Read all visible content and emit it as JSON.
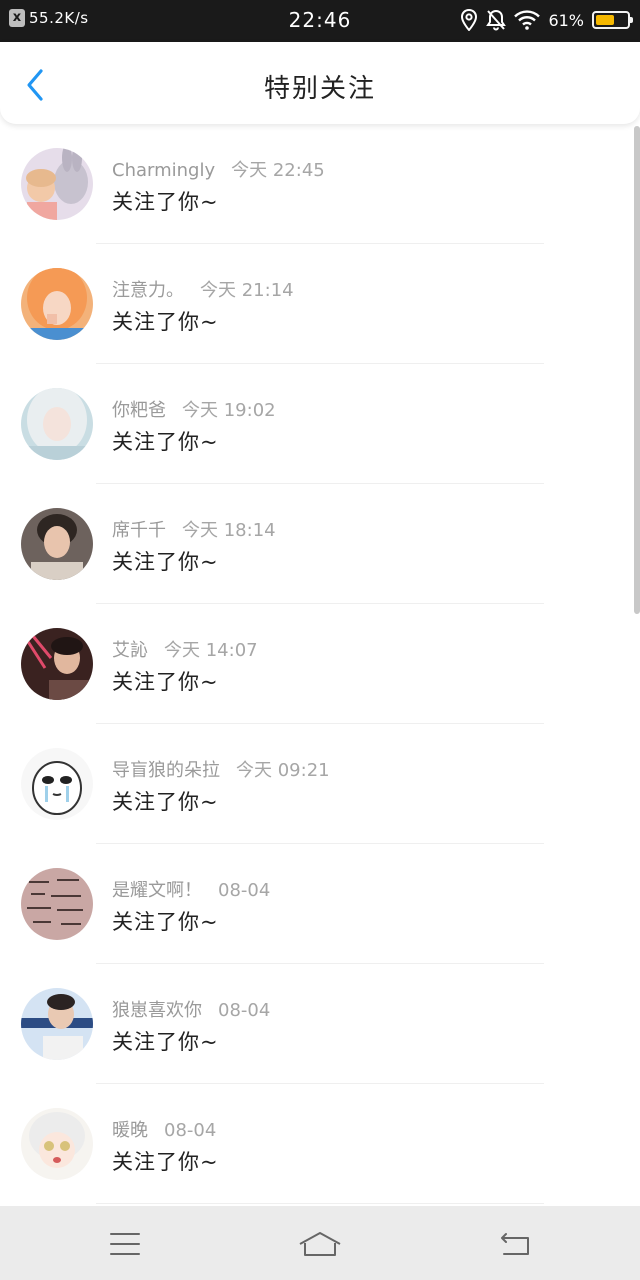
{
  "status_bar": {
    "notification_icon": "x",
    "net_speed": "55.2K/s",
    "time": "22:46",
    "battery_pct": "61%",
    "battery_level": 0.61,
    "battery_color": "#f5b800",
    "icons": [
      "location-icon",
      "bell-off-icon",
      "wifi-icon",
      "battery-icon"
    ]
  },
  "header": {
    "back_icon": "chevron-left-icon",
    "title": "特别关注",
    "accent": "#2196f3"
  },
  "list": {
    "items": [
      {
        "name": "Charmingly",
        "time": "今天  22:45",
        "message": "关注了你~"
      },
      {
        "name": "注意力。",
        "time": "今天  21:14",
        "message": "关注了你~"
      },
      {
        "name": "你粑爸",
        "time": "今天  19:02",
        "message": "关注了你~"
      },
      {
        "name": "席千千",
        "time": "今天  18:14",
        "message": "关注了你~"
      },
      {
        "name": "艾訫",
        "time": "今天  14:07",
        "message": "关注了你~"
      },
      {
        "name": "导盲狼的朵拉",
        "time": "今天  09:21",
        "message": "关注了你~"
      },
      {
        "name": "是耀文啊！",
        "time": "08-04",
        "message": "关注了你~"
      },
      {
        "name": "狼崽喜欢你",
        "time": "08-04",
        "message": "关注了你~"
      },
      {
        "name": "暖晚",
        "time": "08-04",
        "message": "关注了你~"
      }
    ]
  },
  "nav_bar": {
    "icons": [
      "menu-icon",
      "home-icon",
      "back-icon"
    ]
  }
}
